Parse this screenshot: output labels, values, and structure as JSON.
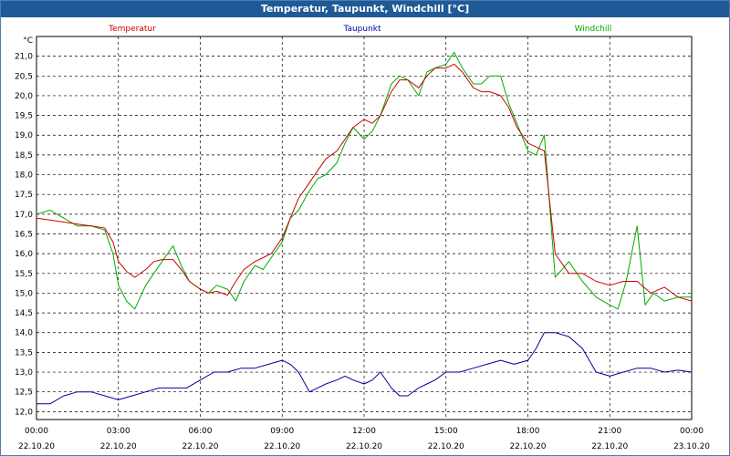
{
  "window": {
    "title": "Temperatur, Taupunkt, Windchill [°C]"
  },
  "chart_data": {
    "type": "line",
    "title": "Temperatur, Taupunkt, Windchill [°C]",
    "ylabel": "°C",
    "xlabel": "",
    "ylim": [
      11.8,
      21.5
    ],
    "xlim": [
      0,
      24
    ],
    "grid": true,
    "legend_placement": "top",
    "y_ticks": [
      "12,0",
      "12,5",
      "13,0",
      "13,5",
      "14,0",
      "14,5",
      "15,0",
      "15,5",
      "16,0",
      "16,5",
      "17,0",
      "17,5",
      "18,0",
      "18,5",
      "19,0",
      "19,5",
      "20,0",
      "20,5",
      "21,0"
    ],
    "x_ticks": [
      {
        "time": "00:00",
        "date": "22.10.20"
      },
      {
        "time": "03:00",
        "date": "22.10.20"
      },
      {
        "time": "06:00",
        "date": "22.10.20"
      },
      {
        "time": "09:00",
        "date": "22.10.20"
      },
      {
        "time": "12:00",
        "date": "22.10.20"
      },
      {
        "time": "15:00",
        "date": "22.10.20"
      },
      {
        "time": "18:00",
        "date": "22.10.20"
      },
      {
        "time": "21:00",
        "date": "22.10.20"
      },
      {
        "time": "00:00",
        "date": "23.10.20"
      }
    ],
    "series": [
      {
        "name": "Temperatur",
        "color": "#cc0000",
        "x": [
          0,
          0.5,
          1,
          1.5,
          2,
          2.5,
          2.8,
          3,
          3.3,
          3.6,
          4,
          4.3,
          4.6,
          5,
          5.3,
          5.6,
          6,
          6.3,
          6.6,
          7,
          7.3,
          7.6,
          8,
          8.3,
          8.6,
          9,
          9.3,
          9.6,
          10,
          10.3,
          10.6,
          11,
          11.3,
          11.6,
          12,
          12.3,
          12.6,
          13,
          13.3,
          13.6,
          14,
          14.3,
          14.6,
          15,
          15.3,
          15.6,
          16,
          16.3,
          16.6,
          17,
          17.3,
          17.6,
          18,
          18.3,
          18.6,
          19,
          19.5,
          20,
          20.5,
          21,
          21.5,
          22,
          22.5,
          23,
          23.5,
          24
        ],
        "y": [
          16.9,
          16.85,
          16.8,
          16.75,
          16.7,
          16.65,
          16.3,
          15.8,
          15.55,
          15.4,
          15.6,
          15.8,
          15.85,
          15.85,
          15.6,
          15.3,
          15.1,
          15.0,
          15.05,
          14.95,
          15.3,
          15.6,
          15.8,
          15.9,
          16.0,
          16.4,
          16.9,
          17.4,
          17.8,
          18.1,
          18.4,
          18.6,
          18.9,
          19.2,
          19.4,
          19.3,
          19.5,
          20.1,
          20.4,
          20.4,
          20.2,
          20.5,
          20.7,
          20.7,
          20.8,
          20.6,
          20.2,
          20.1,
          20.1,
          20.0,
          19.7,
          19.2,
          18.8,
          18.7,
          18.6,
          16.0,
          15.5,
          15.5,
          15.3,
          15.2,
          15.3,
          15.3,
          15.0,
          15.15,
          14.9,
          14.8
        ]
      },
      {
        "name": "Taupunkt",
        "color": "#000099",
        "x": [
          0,
          0.5,
          1,
          1.5,
          2,
          2.5,
          3,
          3.5,
          4,
          4.5,
          5,
          5.5,
          6,
          6.5,
          7,
          7.5,
          8,
          8.5,
          9,
          9.3,
          9.6,
          10,
          10.3,
          10.6,
          11,
          11.3,
          11.6,
          12,
          12.3,
          12.6,
          13,
          13.3,
          13.6,
          14,
          14.3,
          14.6,
          15,
          15.5,
          16,
          16.5,
          17,
          17.5,
          18,
          18.3,
          18.6,
          19,
          19.5,
          20,
          20.5,
          21,
          21.5,
          22,
          22.5,
          23,
          23.5,
          24
        ],
        "y": [
          12.2,
          12.2,
          12.4,
          12.5,
          12.5,
          12.4,
          12.3,
          12.4,
          12.5,
          12.6,
          12.6,
          12.6,
          12.8,
          13.0,
          13.0,
          13.1,
          13.1,
          13.2,
          13.3,
          13.2,
          13.0,
          12.5,
          12.6,
          12.7,
          12.8,
          12.9,
          12.8,
          12.7,
          12.8,
          13.0,
          12.6,
          12.4,
          12.4,
          12.6,
          12.7,
          12.8,
          13.0,
          13.0,
          13.1,
          13.2,
          13.3,
          13.2,
          13.3,
          13.6,
          14.0,
          14.0,
          13.9,
          13.6,
          13.0,
          12.9,
          13.0,
          13.1,
          13.1,
          13.0,
          13.05,
          13.0
        ]
      },
      {
        "name": "Windchill",
        "color": "#00aa00",
        "x": [
          0,
          0.5,
          1,
          1.5,
          2,
          2.5,
          2.8,
          3,
          3.3,
          3.6,
          4,
          4.3,
          4.6,
          5,
          5.3,
          5.6,
          6,
          6.3,
          6.6,
          7,
          7.3,
          7.6,
          8,
          8.3,
          8.6,
          9,
          9.3,
          9.6,
          10,
          10.3,
          10.6,
          11,
          11.3,
          11.6,
          12,
          12.3,
          12.6,
          13,
          13.3,
          13.6,
          14,
          14.3,
          14.6,
          15,
          15.3,
          15.6,
          16,
          16.3,
          16.6,
          17,
          17.3,
          17.6,
          18,
          18.3,
          18.6,
          19,
          19.5,
          20,
          20.5,
          21,
          21.3,
          21.6,
          22,
          22.3,
          22.6,
          23,
          23.5,
          24
        ],
        "y": [
          17.0,
          17.1,
          16.9,
          16.7,
          16.7,
          16.6,
          16.0,
          15.2,
          14.8,
          14.6,
          15.2,
          15.5,
          15.8,
          16.2,
          15.7,
          15.3,
          15.1,
          15.0,
          15.2,
          15.1,
          14.8,
          15.3,
          15.7,
          15.6,
          15.9,
          16.3,
          16.9,
          17.1,
          17.6,
          17.9,
          18.0,
          18.3,
          18.8,
          19.2,
          18.9,
          19.1,
          19.5,
          20.3,
          20.5,
          20.4,
          20.0,
          20.6,
          20.7,
          20.8,
          21.1,
          20.7,
          20.3,
          20.3,
          20.5,
          20.5,
          19.8,
          19.3,
          18.6,
          18.5,
          19.0,
          15.4,
          15.8,
          15.3,
          14.9,
          14.7,
          14.6,
          15.3,
          16.7,
          14.7,
          15.0,
          14.8,
          14.9,
          14.9
        ]
      }
    ]
  }
}
